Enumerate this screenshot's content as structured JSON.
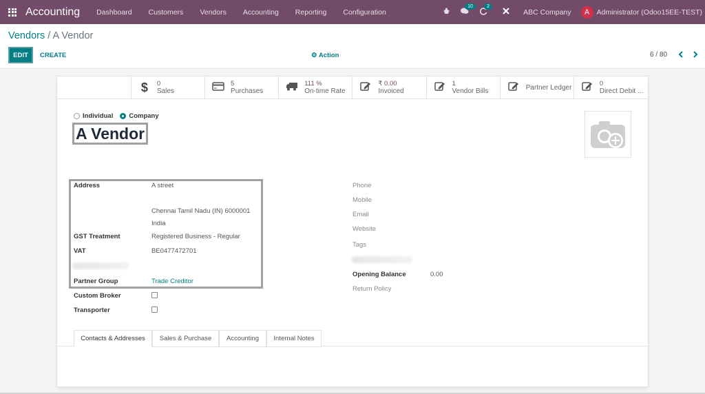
{
  "navbar": {
    "app_name": "Accounting",
    "menu": [
      "Dashboard",
      "Customers",
      "Vendors",
      "Accounting",
      "Reporting",
      "Configuration"
    ],
    "icons": {
      "bug": "bug-icon",
      "chat": "chat-icon",
      "activity": "activity-icon",
      "tools": "tools-icon"
    },
    "chat_badge": "10",
    "activity_badge": "2",
    "company": "ABC Company",
    "avatar_initial": "A",
    "user": "Administrator (Odoo15EE-TEST)"
  },
  "control_panel": {
    "breadcrumb_parent": "Vendors",
    "breadcrumb_sep": "/",
    "breadcrumb_current": "A Vendor",
    "edit_label": "EDIT",
    "create_label": "CREATE",
    "action_label": "Action",
    "pager": "6 / 80",
    "prev": "‹",
    "next": "›"
  },
  "stat_buttons": [
    {
      "icon": "dollar-icon",
      "value": "0",
      "label": "Sales"
    },
    {
      "icon": "credit-card-icon",
      "value": "5",
      "label": "Purchases"
    },
    {
      "icon": "truck-icon",
      "value": "111 %",
      "label": "On-time Rate"
    },
    {
      "icon": "edit-icon",
      "value": "₹ 0.00",
      "label": "Invoiced"
    },
    {
      "icon": "edit-icon",
      "value": "1",
      "label": "Vendor Bills"
    },
    {
      "icon": "edit-icon",
      "value": "",
      "label": "Partner Ledger"
    },
    {
      "icon": "edit-icon",
      "value": "0",
      "label": "Direct Debit ..."
    }
  ],
  "form": {
    "type_options": [
      "Individual",
      "Company"
    ],
    "type_selected": "Company",
    "name": "A Vendor",
    "left_fields": {
      "address_label": "Address",
      "street": "A street",
      "city_line": "Chennai  Tamil Nadu (IN)  6000001",
      "country": "India",
      "gst_label": "GST Treatment",
      "gst_value": "Registered Business - Regular",
      "vat_label": "VAT",
      "vat_value": "BE0477472701",
      "partner_group_label": "Partner Group",
      "partner_group_value": "Trade Creditor",
      "custom_broker_label": "Custom Broker",
      "transporter_label": "Transporter"
    },
    "right_fields": {
      "phone": "Phone",
      "mobile": "Mobile",
      "email": "Email",
      "website": "Website",
      "tags": "Tags",
      "opening_balance_label": "Opening Balance",
      "opening_balance_value": "0.00",
      "return_policy": "Return Policy"
    }
  },
  "tabs": [
    "Contacts & Addresses",
    "Sales & Purchase",
    "Accounting",
    "Internal Notes"
  ],
  "colors": {
    "brand": "#714b67",
    "accent": "#017e84"
  }
}
